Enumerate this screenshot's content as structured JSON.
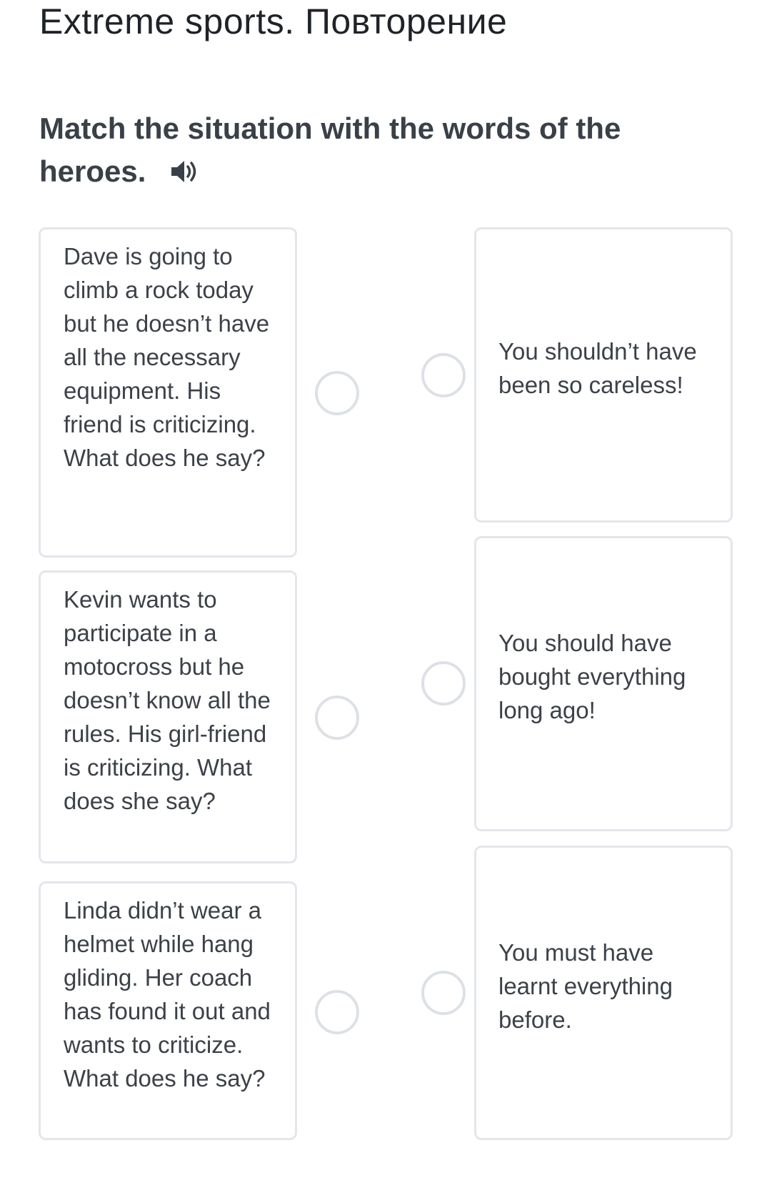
{
  "header": {
    "title": "Extreme sports. Повторение"
  },
  "task": {
    "instruction": "Match the situation with the words of the heroes.",
    "audio_icon": "speaker-icon"
  },
  "situations": [
    {
      "text": "Dave is going to climb a rock today but he doesn’t have all the necessary equipment. His friend is criticizing. What does he say?"
    },
    {
      "text": "Kevin wants to participate in a motocross but he doesn’t know all the rules. His girl-friend is criticizing. What does she say?"
    },
    {
      "text": "Linda didn’t wear a helmet while hang gliding. Her coach has found it out and wants to criticize. What does he say?"
    }
  ],
  "answers": [
    {
      "text": "You shouldn’t have been so careless!"
    },
    {
      "text": "You should have bought everything long ago!"
    },
    {
      "text": "You must have learnt everything before."
    }
  ],
  "colors": {
    "border": "#e3e6ea",
    "radio_border": "#dde1e6",
    "text": "#3c4149",
    "title": "#1f2329"
  }
}
